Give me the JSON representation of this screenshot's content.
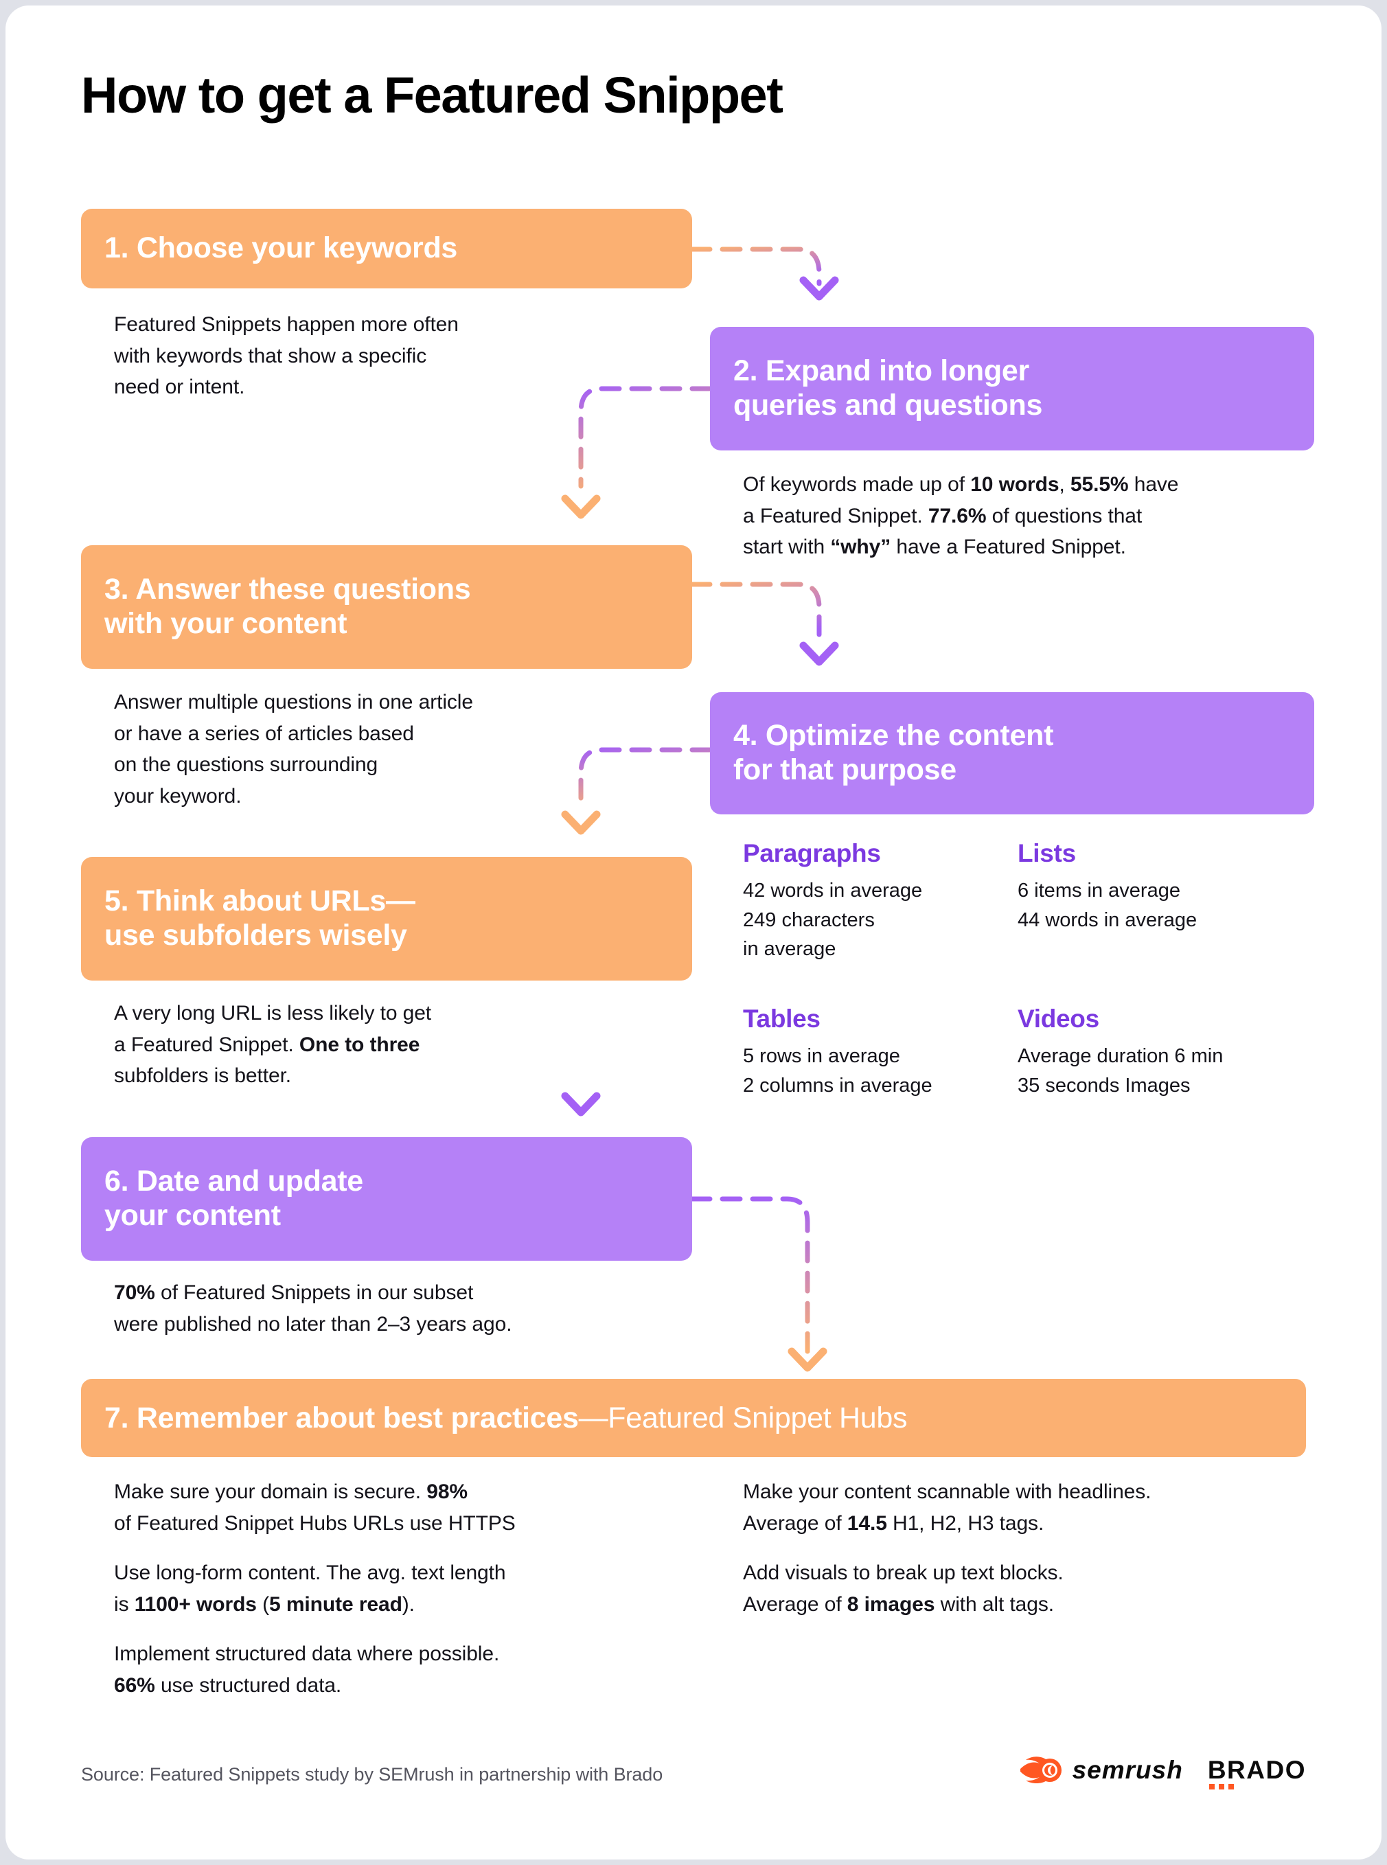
{
  "title": "How to get a Featured Snippet",
  "colors": {
    "orange": "#fbb072",
    "purple": "#b581f7",
    "accent_violet": "#7b39e0",
    "brand_orange": "#ff5722",
    "text": "#14131a",
    "muted": "#55555f",
    "page_bg": "#dfe1e8",
    "card_bg": "#ffffff"
  },
  "steps": [
    {
      "id": 1,
      "heading": "1. Choose your keywords",
      "color": "orange",
      "body_html": "Featured Snippets happen more often<br>with keywords that show a specific<br>need or intent."
    },
    {
      "id": 2,
      "heading": "2. Expand into longer<br>queries and questions",
      "color": "purple",
      "body_html": "Of keywords made up of <b>10 words</b>, <b>55.5%</b> have<br>a Featured Snippet. <b>77.6%</b> of questions that<br>start with <b>&ldquo;why&rdquo;</b> have a Featured Snippet."
    },
    {
      "id": 3,
      "heading": "3. Answer these questions<br>with your content",
      "color": "orange",
      "body_html": "Answer multiple questions in one article<br>or have a series of articles based<br>on the questions surrounding<br>your keyword."
    },
    {
      "id": 4,
      "heading": "4. Optimize the content<br>for that purpose",
      "color": "purple",
      "body_html": ""
    },
    {
      "id": 5,
      "heading": "5. Think about URLs&mdash;<br>use subfolders wisely",
      "color": "orange",
      "body_html": "A very long URL is less likely to get<br>a Featured Snippet. <b>One to three</b><br>subfolders is better."
    },
    {
      "id": 6,
      "heading": "6. Date and update<br>your content",
      "color": "purple",
      "body_html": "<b>70%</b> of Featured Snippets in our subset<br>were published no later than 2&ndash;3 years ago."
    }
  ],
  "step4_stats": [
    {
      "title": "Paragraphs",
      "lines": [
        "42 words in average",
        "249 characters",
        "in average"
      ]
    },
    {
      "title": "Lists",
      "lines": [
        "6 items in average",
        "44 words in average"
      ]
    },
    {
      "title": "Tables",
      "lines": [
        "5 rows in average",
        "2 columns in average"
      ]
    },
    {
      "title": "Videos",
      "lines": [
        "Average duration 6 min",
        "35 seconds Images"
      ]
    }
  ],
  "step7": {
    "heading_strong": "7. Remember about best practices",
    "heading_light": "—Featured Snippet Hubs",
    "left_paragraphs": [
      "Make sure your domain is secure. <b>98%</b><br>of Featured Snippet Hubs URLs use HTTPS",
      "Use long-form content. The avg. text length<br>is <b>1100+ words</b> (<b>5 minute read</b>).",
      "Implement structured data where possible.<br><b>66%</b> use structured data."
    ],
    "right_paragraphs": [
      "Make your content scannable with headlines.<br>Average of <b>14.5</b> H1, H2, H3 tags.",
      "Add visuals to break up text blocks.<br>Average of <b>8 images</b> with alt tags."
    ]
  },
  "footer": {
    "source": "Source: Featured Snippets study by SEMrush in partnership with Brado",
    "logo_semrush": "semrush",
    "logo_brado": "BRADO"
  }
}
